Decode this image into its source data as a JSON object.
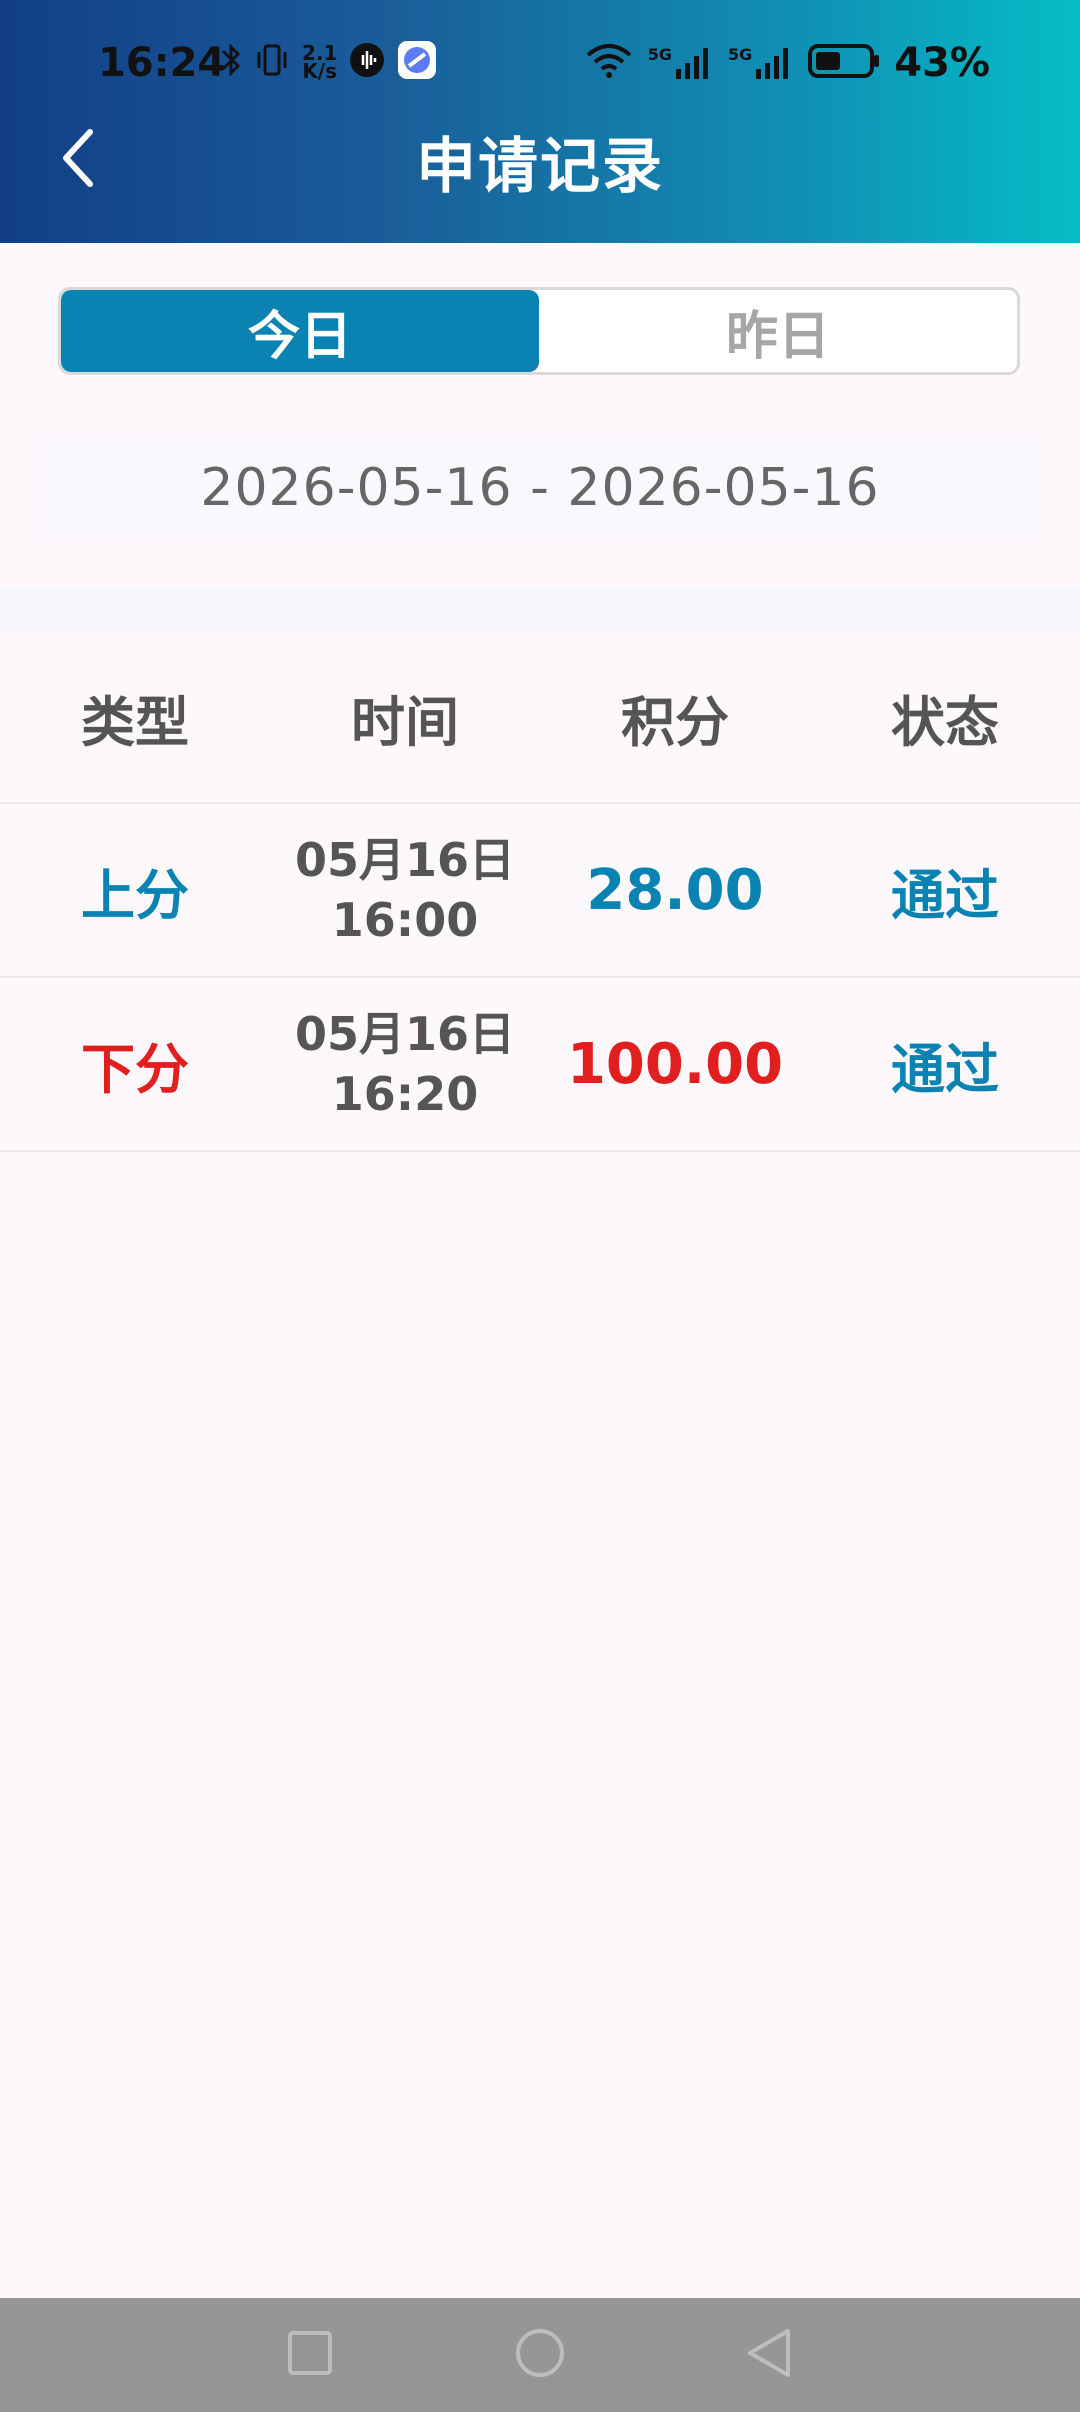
{
  "status_bar": {
    "time": "16:24",
    "net_speed_value": "2.1",
    "net_speed_unit": "K/s",
    "battery_percent": "43%",
    "signal1_label": "5G",
    "signal2_label": "5G"
  },
  "header": {
    "title": "申请记录"
  },
  "tabs": [
    {
      "label": "今日",
      "active": true
    },
    {
      "label": "昨日",
      "active": false
    }
  ],
  "date_range": "2026-05-16 - 2026-05-16",
  "table": {
    "headers": [
      "类型",
      "时间",
      "积分",
      "状态"
    ],
    "rows": [
      {
        "type": "上分",
        "date": "05月16日",
        "time": "16:00",
        "points": "28.00",
        "status": "通过"
      },
      {
        "type": "下分",
        "date": "05月16日",
        "time": "16:20",
        "points": "100.00",
        "status": "通过"
      }
    ]
  },
  "colors": {
    "accent": "#0b83b2",
    "negative": "#e21f1f",
    "header_gradient_start": "#123f86",
    "header_gradient_end": "#05bdc6"
  },
  "icons": {
    "back": "back-chevron-icon",
    "nav_recent": "square-icon",
    "nav_home": "circle-icon",
    "nav_back": "triangle-back-icon"
  }
}
